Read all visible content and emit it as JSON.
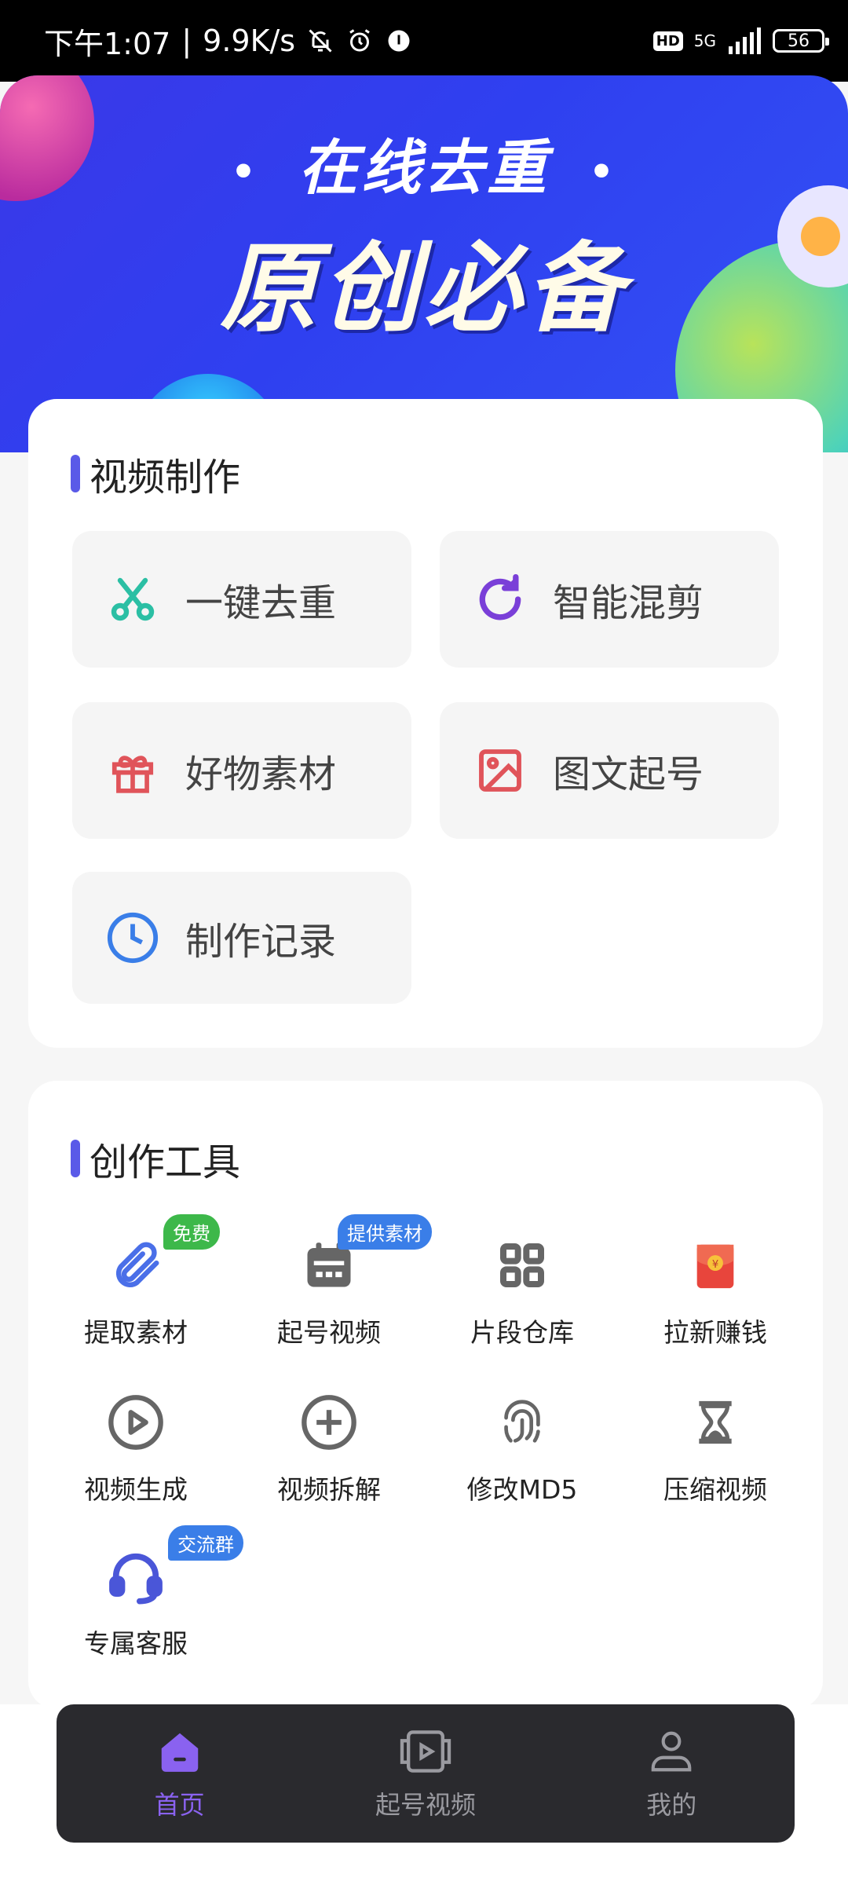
{
  "status_bar": {
    "time": "下午1:07",
    "speed": "9.9K/s",
    "network": "5G",
    "hd": "HD",
    "battery": "56"
  },
  "banner": {
    "line1": "在线去重",
    "line2": "原创必备"
  },
  "video_section": {
    "title": "视频制作",
    "tiles": [
      {
        "label": "一键去重",
        "icon": "scissors-icon",
        "color": "#2bbfa4"
      },
      {
        "label": "智能混剪",
        "icon": "refresh-icon",
        "color": "#7a3fd8"
      },
      {
        "label": "好物素材",
        "icon": "gift-icon",
        "color": "#e0545a"
      },
      {
        "label": "图文起号",
        "icon": "image-icon",
        "color": "#e0545a"
      },
      {
        "label": "制作记录",
        "icon": "clock-icon",
        "color": "#3a7ee8"
      }
    ]
  },
  "tools_section": {
    "title": "创作工具",
    "tools": [
      {
        "label": "提取素材",
        "icon": "paperclip-icon",
        "tag": "免费",
        "tag_color": "#3db84a"
      },
      {
        "label": "起号视频",
        "icon": "calendar-icon",
        "tag": "提供素材",
        "tag_color": "#3a7ee8"
      },
      {
        "label": "片段仓库",
        "icon": "grid-icon"
      },
      {
        "label": "拉新赚钱",
        "icon": "red-envelope-icon"
      },
      {
        "label": "视频生成",
        "icon": "play-circle-icon"
      },
      {
        "label": "视频拆解",
        "icon": "plus-circle-icon"
      },
      {
        "label": "修改MD5",
        "icon": "fingerprint-icon"
      },
      {
        "label": "压缩视频",
        "icon": "hourglass-icon"
      },
      {
        "label": "专属客服",
        "icon": "headset-icon",
        "tag": "交流群",
        "tag_color": "#3a7ee8"
      }
    ]
  },
  "bottom_nav": {
    "items": [
      {
        "label": "首页",
        "icon": "home-icon",
        "active": true
      },
      {
        "label": "起号视频",
        "icon": "video-icon",
        "active": false
      },
      {
        "label": "我的",
        "icon": "user-icon",
        "active": false
      }
    ],
    "active_color": "#8a62f0"
  }
}
